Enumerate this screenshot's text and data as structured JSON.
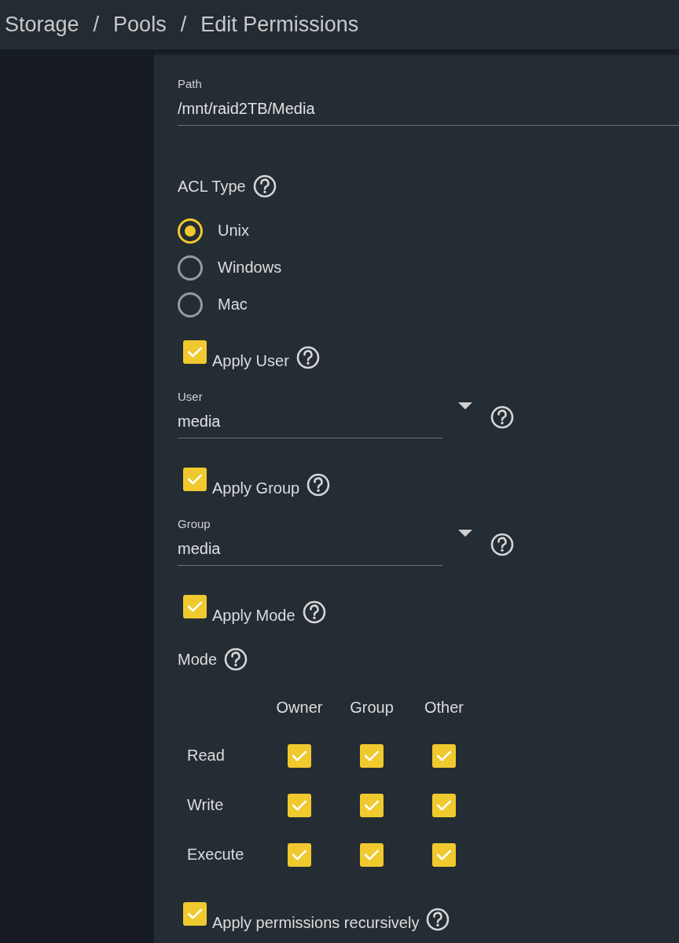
{
  "breadcrumb": [
    {
      "kind": "crumb",
      "text": "Storage"
    },
    {
      "kind": "separator",
      "text": "/"
    },
    {
      "kind": "crumb",
      "text": "Pools"
    },
    {
      "kind": "separator",
      "text": "/"
    },
    {
      "kind": "crumb",
      "text": "Edit Permissions"
    }
  ],
  "form": [
    {
      "kind": "text_field",
      "label": "Path",
      "value": "/mnt/raid2TB/Media"
    },
    {
      "kind": "heading",
      "label": "ACL Type",
      "help": true
    },
    {
      "kind": "radio_group",
      "options": [
        {
          "label": "Unix",
          "selected": true
        },
        {
          "label": "Windows",
          "selected": false
        },
        {
          "label": "Mac",
          "selected": false
        }
      ]
    },
    {
      "kind": "checkbox",
      "label": "Apply User",
      "checked": true,
      "help": true
    },
    {
      "kind": "select",
      "label": "User",
      "value": "media",
      "help": true
    },
    {
      "kind": "checkbox",
      "label": "Apply Group",
      "checked": true,
      "help": true
    },
    {
      "kind": "select",
      "label": "Group",
      "value": "media",
      "help": true
    },
    {
      "kind": "checkbox",
      "label": "Apply Mode",
      "checked": true,
      "help": true
    },
    {
      "kind": "heading",
      "label": "Mode",
      "help": true
    },
    {
      "kind": "mode_table",
      "columns": [
        "Owner",
        "Group",
        "Other"
      ],
      "rows": [
        {
          "label": "Read",
          "cells": [
            {
              "checked": true
            },
            {
              "checked": true
            },
            {
              "checked": true
            }
          ]
        },
        {
          "label": "Write",
          "cells": [
            {
              "checked": true
            },
            {
              "checked": true
            },
            {
              "checked": true
            }
          ]
        },
        {
          "label": "Execute",
          "cells": [
            {
              "checked": true
            },
            {
              "checked": true
            },
            {
              "checked": true
            }
          ]
        }
      ]
    },
    {
      "kind": "checkbox",
      "label": "Apply permissions recursively",
      "checked": true,
      "help": true
    }
  ]
}
